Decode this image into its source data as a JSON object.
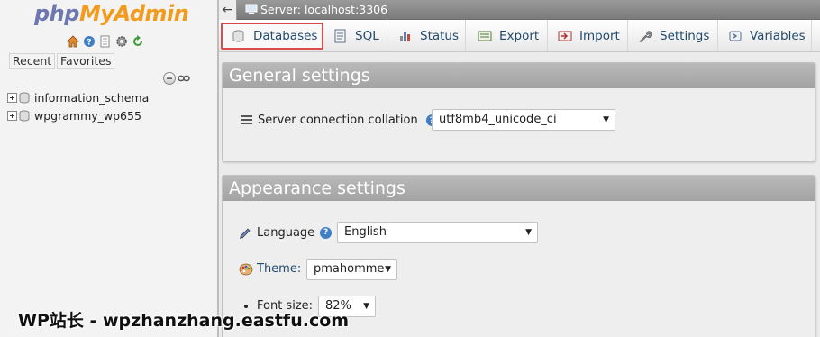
{
  "logo": {
    "part1": "php",
    "part2": "MyAdmin"
  },
  "nav": {
    "icons": [
      "home-icon",
      "help-icon",
      "documentation-icon",
      "settings-gear-icon",
      "reload-icon"
    ],
    "tabs": {
      "recent": "Recent",
      "favorites": "Favorites"
    },
    "databases": [
      "information_schema",
      "wpgrammy_wp655"
    ]
  },
  "serverbar": {
    "back": "←",
    "label": "Server: localhost:3306"
  },
  "tabs": [
    {
      "label": "Databases",
      "icon": "database-icon",
      "active": true
    },
    {
      "label": "SQL",
      "icon": "sql-icon"
    },
    {
      "label": "Status",
      "icon": "status-chart-icon"
    },
    {
      "label": "Export",
      "icon": "export-icon"
    },
    {
      "label": "Import",
      "icon": "import-icon"
    },
    {
      "label": "Settings",
      "icon": "wrench-icon"
    },
    {
      "label": "Variables",
      "icon": "variables-icon"
    }
  ],
  "general": {
    "title": "General settings",
    "collation_label": "Server connection collation",
    "collation_colon": ":",
    "collation_value": "utf8mb4_unicode_ci"
  },
  "appearance": {
    "title": "Appearance settings",
    "language_label": "Language",
    "language_value": "English",
    "theme_label": "Theme:",
    "theme_value": "pmahomme",
    "fontsize_label": "Font size:",
    "fontsize_value": "82%"
  },
  "watermark": "WP站长 - wpzhanzhang.eastfu.com",
  "colors": {
    "accent_red": "#d94c4c",
    "link_blue": "#234a6d",
    "logo_blue": "#6c78af",
    "logo_orange": "#f29c1f"
  }
}
